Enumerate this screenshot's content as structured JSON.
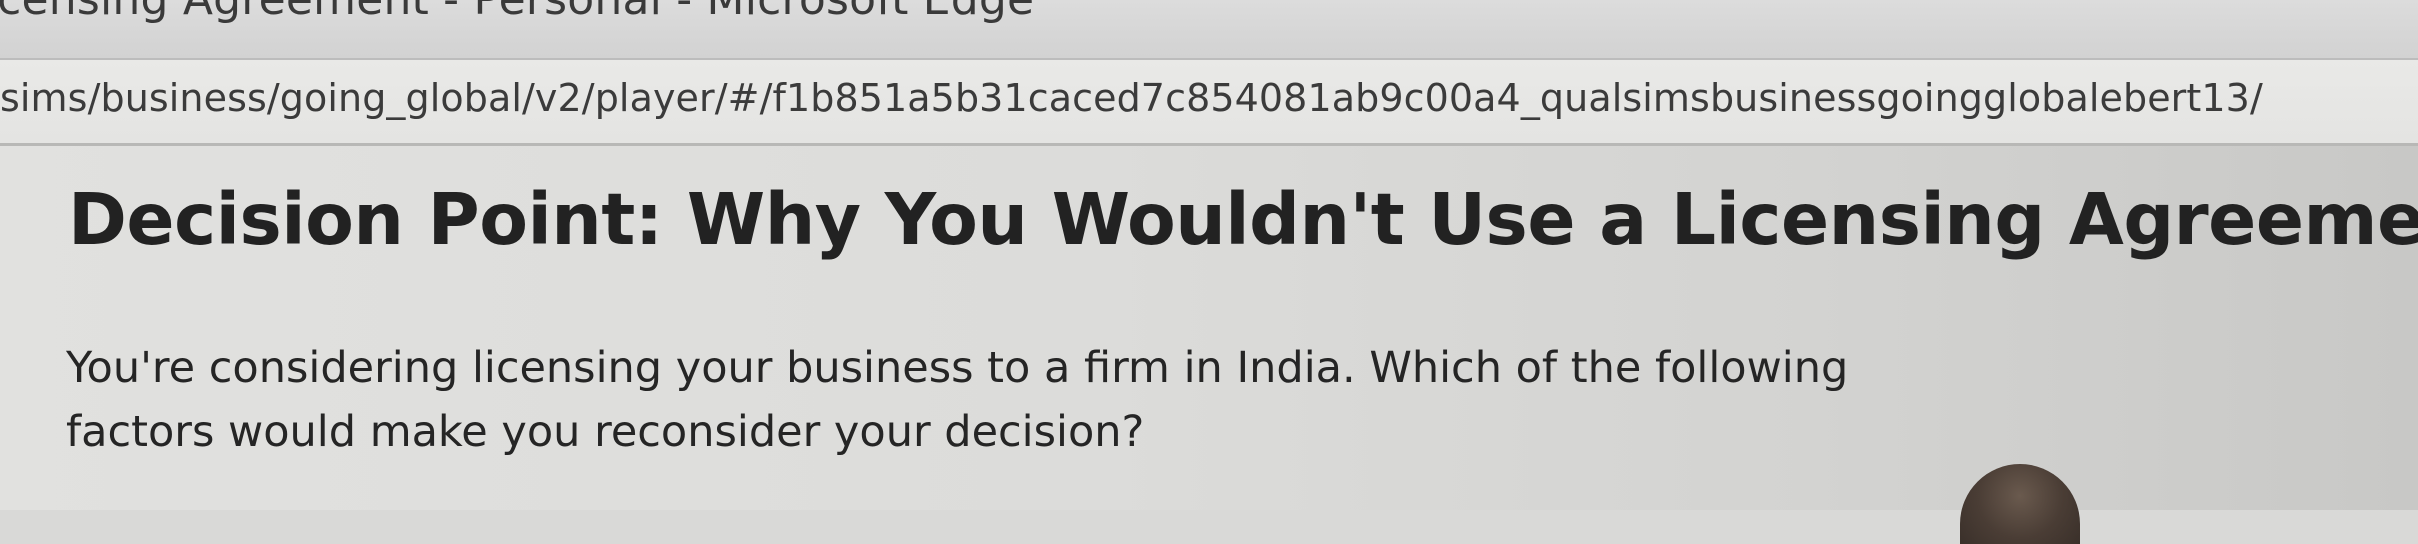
{
  "browser": {
    "window_title": "Licensing Agreement - Personal - Microsoft Edge",
    "url": "sims/business/going_global/v2/player/#/f1b851a5b31caced7c854081ab9c00a4_qualsimsbusinessgoingglobalebert13/"
  },
  "page": {
    "title": "Decision Point: Why You Wouldn't Use a Licensing Agreement",
    "question": "You're considering licensing your business to a firm in India. Which of the following factors would make you reconsider your decision?"
  }
}
